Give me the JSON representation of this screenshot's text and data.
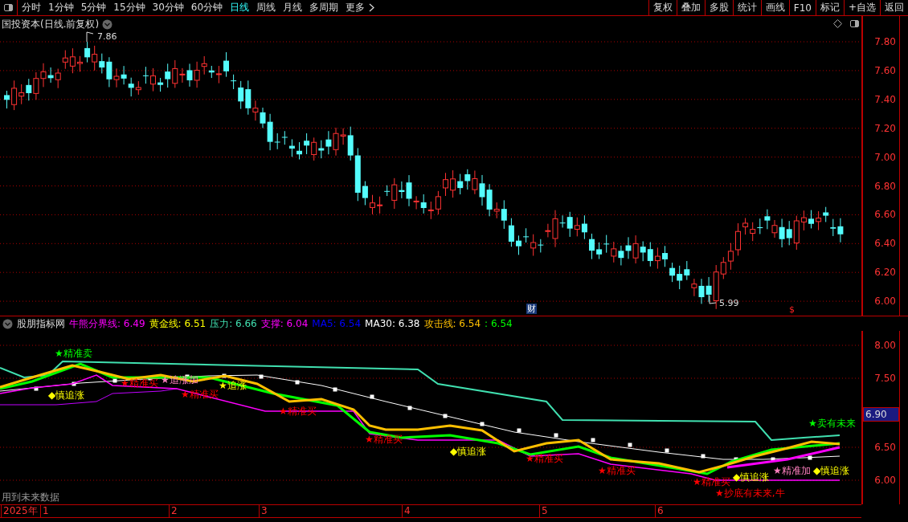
{
  "toolbar": {
    "periods": [
      {
        "label": "分时",
        "selected": false
      },
      {
        "label": "1分钟",
        "selected": false
      },
      {
        "label": "5分钟",
        "selected": false
      },
      {
        "label": "15分钟",
        "selected": false
      },
      {
        "label": "30分钟",
        "selected": false
      },
      {
        "label": "60分钟",
        "selected": false
      },
      {
        "label": "日线",
        "selected": true
      },
      {
        "label": "周线",
        "selected": false
      },
      {
        "label": "月线",
        "selected": false
      },
      {
        "label": "多周期",
        "selected": false
      },
      {
        "label": "更多",
        "selected": false
      }
    ],
    "actions": [
      "复权",
      "叠加",
      "多股",
      "统计",
      "画线",
      "F10",
      "标记",
      "+自选",
      "返回"
    ]
  },
  "title": "国投资本(日线.前复权)",
  "price_axis": [
    "7.80",
    "7.60",
    "7.40",
    "7.20",
    "7.00",
    "6.80",
    "6.60",
    "6.40",
    "6.20",
    "6.00"
  ],
  "price_marks": {
    "high": "7.86",
    "low": "5.99",
    "finance": "财",
    "dollar": "$"
  },
  "indicator": {
    "name": "股朋指标网",
    "legend": [
      {
        "text": "牛熊分界线: 6.49",
        "color": "#ff00ff"
      },
      {
        "text": "黄金线: 6.51",
        "color": "#ffff00"
      },
      {
        "text": "压力: 6.66",
        "color": "#40e0b0"
      },
      {
        "text": "支撑: 6.04",
        "color": "#ff00ff"
      },
      {
        "text": "MA5: 6.54",
        "color": "#0000ff"
      },
      {
        "text": "MA30: 6.38",
        "color": "#ffffff"
      },
      {
        "text": "攻击线: 6.54",
        "color": "#ffc000"
      },
      {
        "text": ": 6.54",
        "color": "#00ff00"
      }
    ],
    "axis": [
      {
        "label": "8.00",
        "highlighted": false
      },
      {
        "label": "7.50",
        "highlighted": false
      },
      {
        "label": "6.90",
        "highlighted": true
      },
      {
        "label": "6.50",
        "highlighted": false
      },
      {
        "label": "6.00",
        "highlighted": false
      }
    ],
    "signals": [
      {
        "text": "★精准卖",
        "color": "#00ff00"
      },
      {
        "text": "◆慎追涨",
        "color": "#ffff00"
      },
      {
        "text": "★精准买",
        "color": "#ff0000"
      },
      {
        "text": "★追涨加",
        "color": "#ff80c0"
      },
      {
        "text": "★精准买",
        "color": "#ff0000"
      },
      {
        "text": "★追涨",
        "color": "#ffff00"
      },
      {
        "text": "★精准买",
        "color": "#ff0000"
      },
      {
        "text": "★精准买",
        "color": "#ff0000"
      },
      {
        "text": "◆慎追涨",
        "color": "#ffff00"
      },
      {
        "text": "★精准买",
        "color": "#ff0000"
      },
      {
        "text": "★精准买",
        "color": "#ff0000"
      },
      {
        "text": "★精准买",
        "color": "#ff0000"
      },
      {
        "text": "◆慎追涨",
        "color": "#ffff00"
      },
      {
        "text": "★精准加",
        "color": "#ff80c0"
      },
      {
        "text": "◆慎追涨",
        "color": "#ffff00"
      },
      {
        "text": "★抄底有未来,牛",
        "color": "#ff0000"
      },
      {
        "text": "★卖有未来",
        "color": "#00ff00"
      }
    ]
  },
  "note": "用到未来数据",
  "date_axis": [
    "2025年",
    "1",
    "2",
    "3",
    "4",
    "5",
    "6"
  ]
}
